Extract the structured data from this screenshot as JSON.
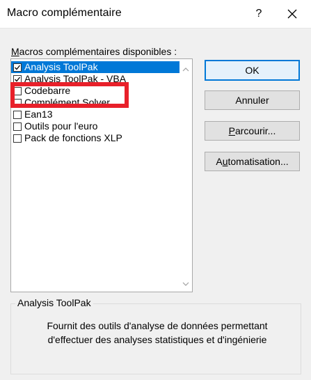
{
  "window": {
    "title": "Macro complémentaire",
    "help_label": "?",
    "close_icon": "close-icon"
  },
  "list": {
    "label_accel": "M",
    "label_rest": "acros complémentaires disponibles :",
    "items": [
      {
        "label": "Analysis ToolPak",
        "checked": true,
        "selected": true
      },
      {
        "label": "Analysis ToolPak - VBA",
        "checked": true,
        "selected": false
      },
      {
        "label": "Codebarre",
        "checked": false,
        "selected": false
      },
      {
        "label": "Complément Solver",
        "checked": false,
        "selected": false
      },
      {
        "label": "Ean13",
        "checked": false,
        "selected": false
      },
      {
        "label": "Outils pour l'euro",
        "checked": false,
        "selected": false
      },
      {
        "label": "Pack de fonctions XLP",
        "checked": false,
        "selected": false
      }
    ],
    "highlighted_item": "Codebarre"
  },
  "buttons": {
    "ok": "OK",
    "annuler": "Annuler",
    "parcourir_accel": "P",
    "parcourir_rest": "arcourir...",
    "auto_a": "A",
    "auto_accel": "u",
    "auto_rest": "tomatisation..."
  },
  "description": {
    "title": "Analysis ToolPak",
    "line1": "Fournit des outils d'analyse de données permettant",
    "line2": "d'effectuer des analyses statistiques et d'ingénierie"
  },
  "colors": {
    "selection": "#0078d7",
    "highlight_border": "#e8202a",
    "dialog_bg": "#f0f0f0"
  }
}
